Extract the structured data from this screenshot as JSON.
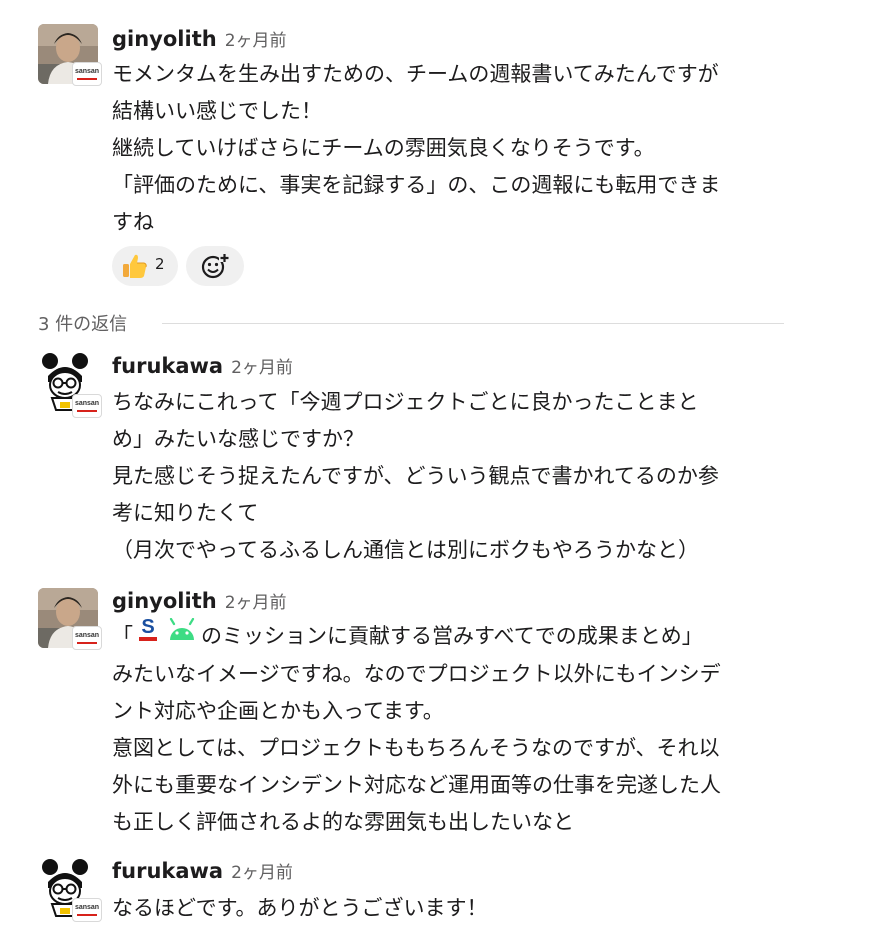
{
  "thread": {
    "messages": [
      {
        "author": "ginyolith",
        "time": "2ヶ月前",
        "badge": "sansan",
        "avatar_icon": "user-photo-avatar",
        "lines": [
          "モメンタムを生み出すための、チームの週報書いてみたんですが",
          "結構いい感じでした！",
          "継続していけばさらにチームの雰囲気良くなりそうです。",
          "「評価のために、事実を記録する」の、この週報にも転用できま",
          "すね"
        ],
        "reactions": [
          {
            "emoji": "thumbs-up-icon",
            "count": "2"
          }
        ],
        "add_reaction_icon": "add-reaction-icon"
      },
      {
        "author": "furukawa",
        "time": "2ヶ月前",
        "badge": "sansan",
        "avatar_icon": "illustrated-avatar",
        "lines": [
          "ちなみにこれって「今週プロジェクトごとに良かったことまと",
          "め」みたいな感じですか？",
          "見た感じそう捉えたんですが、どういう観点で書かれてるのか参",
          "考に知りたくて",
          "（月次でやってるふるしん通信とは別にボクもやろうかなと）"
        ]
      },
      {
        "author": "ginyolith",
        "time": "2ヶ月前",
        "badge": "sansan",
        "avatar_icon": "user-photo-avatar",
        "first_line_open": "「",
        "first_line_rest": "のミッションに貢献する営みすべてでの成果まとめ」",
        "inline_icons": [
          "sansan-s-logo-icon",
          "android-icon"
        ],
        "lines": [
          "みたいなイメージですね。なのでプロジェクト以外にもインシデ",
          "ント対応や企画とかも入ってます。",
          "意図としては、プロジェクトももちろんそうなのですが、それ以",
          "外にも重要なインシデント対応など運用面等の仕事を完遂した人",
          "も正しく評価されるよ的な雰囲気も出したいなと"
        ]
      },
      {
        "author": "furukawa",
        "time": "2ヶ月前",
        "badge": "sansan",
        "avatar_icon": "illustrated-avatar",
        "lines": [
          "なるほどです。ありがとうございます！"
        ]
      }
    ],
    "replies_label": "3 件の返信"
  },
  "colors": {
    "text": "#1d1c1d",
    "muted": "#616061",
    "reaction_bg": "#f0f0f0",
    "sansan_red": "#d7221b",
    "sansan_blue": "#1a4fa0",
    "android_green": "#3ddc84"
  }
}
